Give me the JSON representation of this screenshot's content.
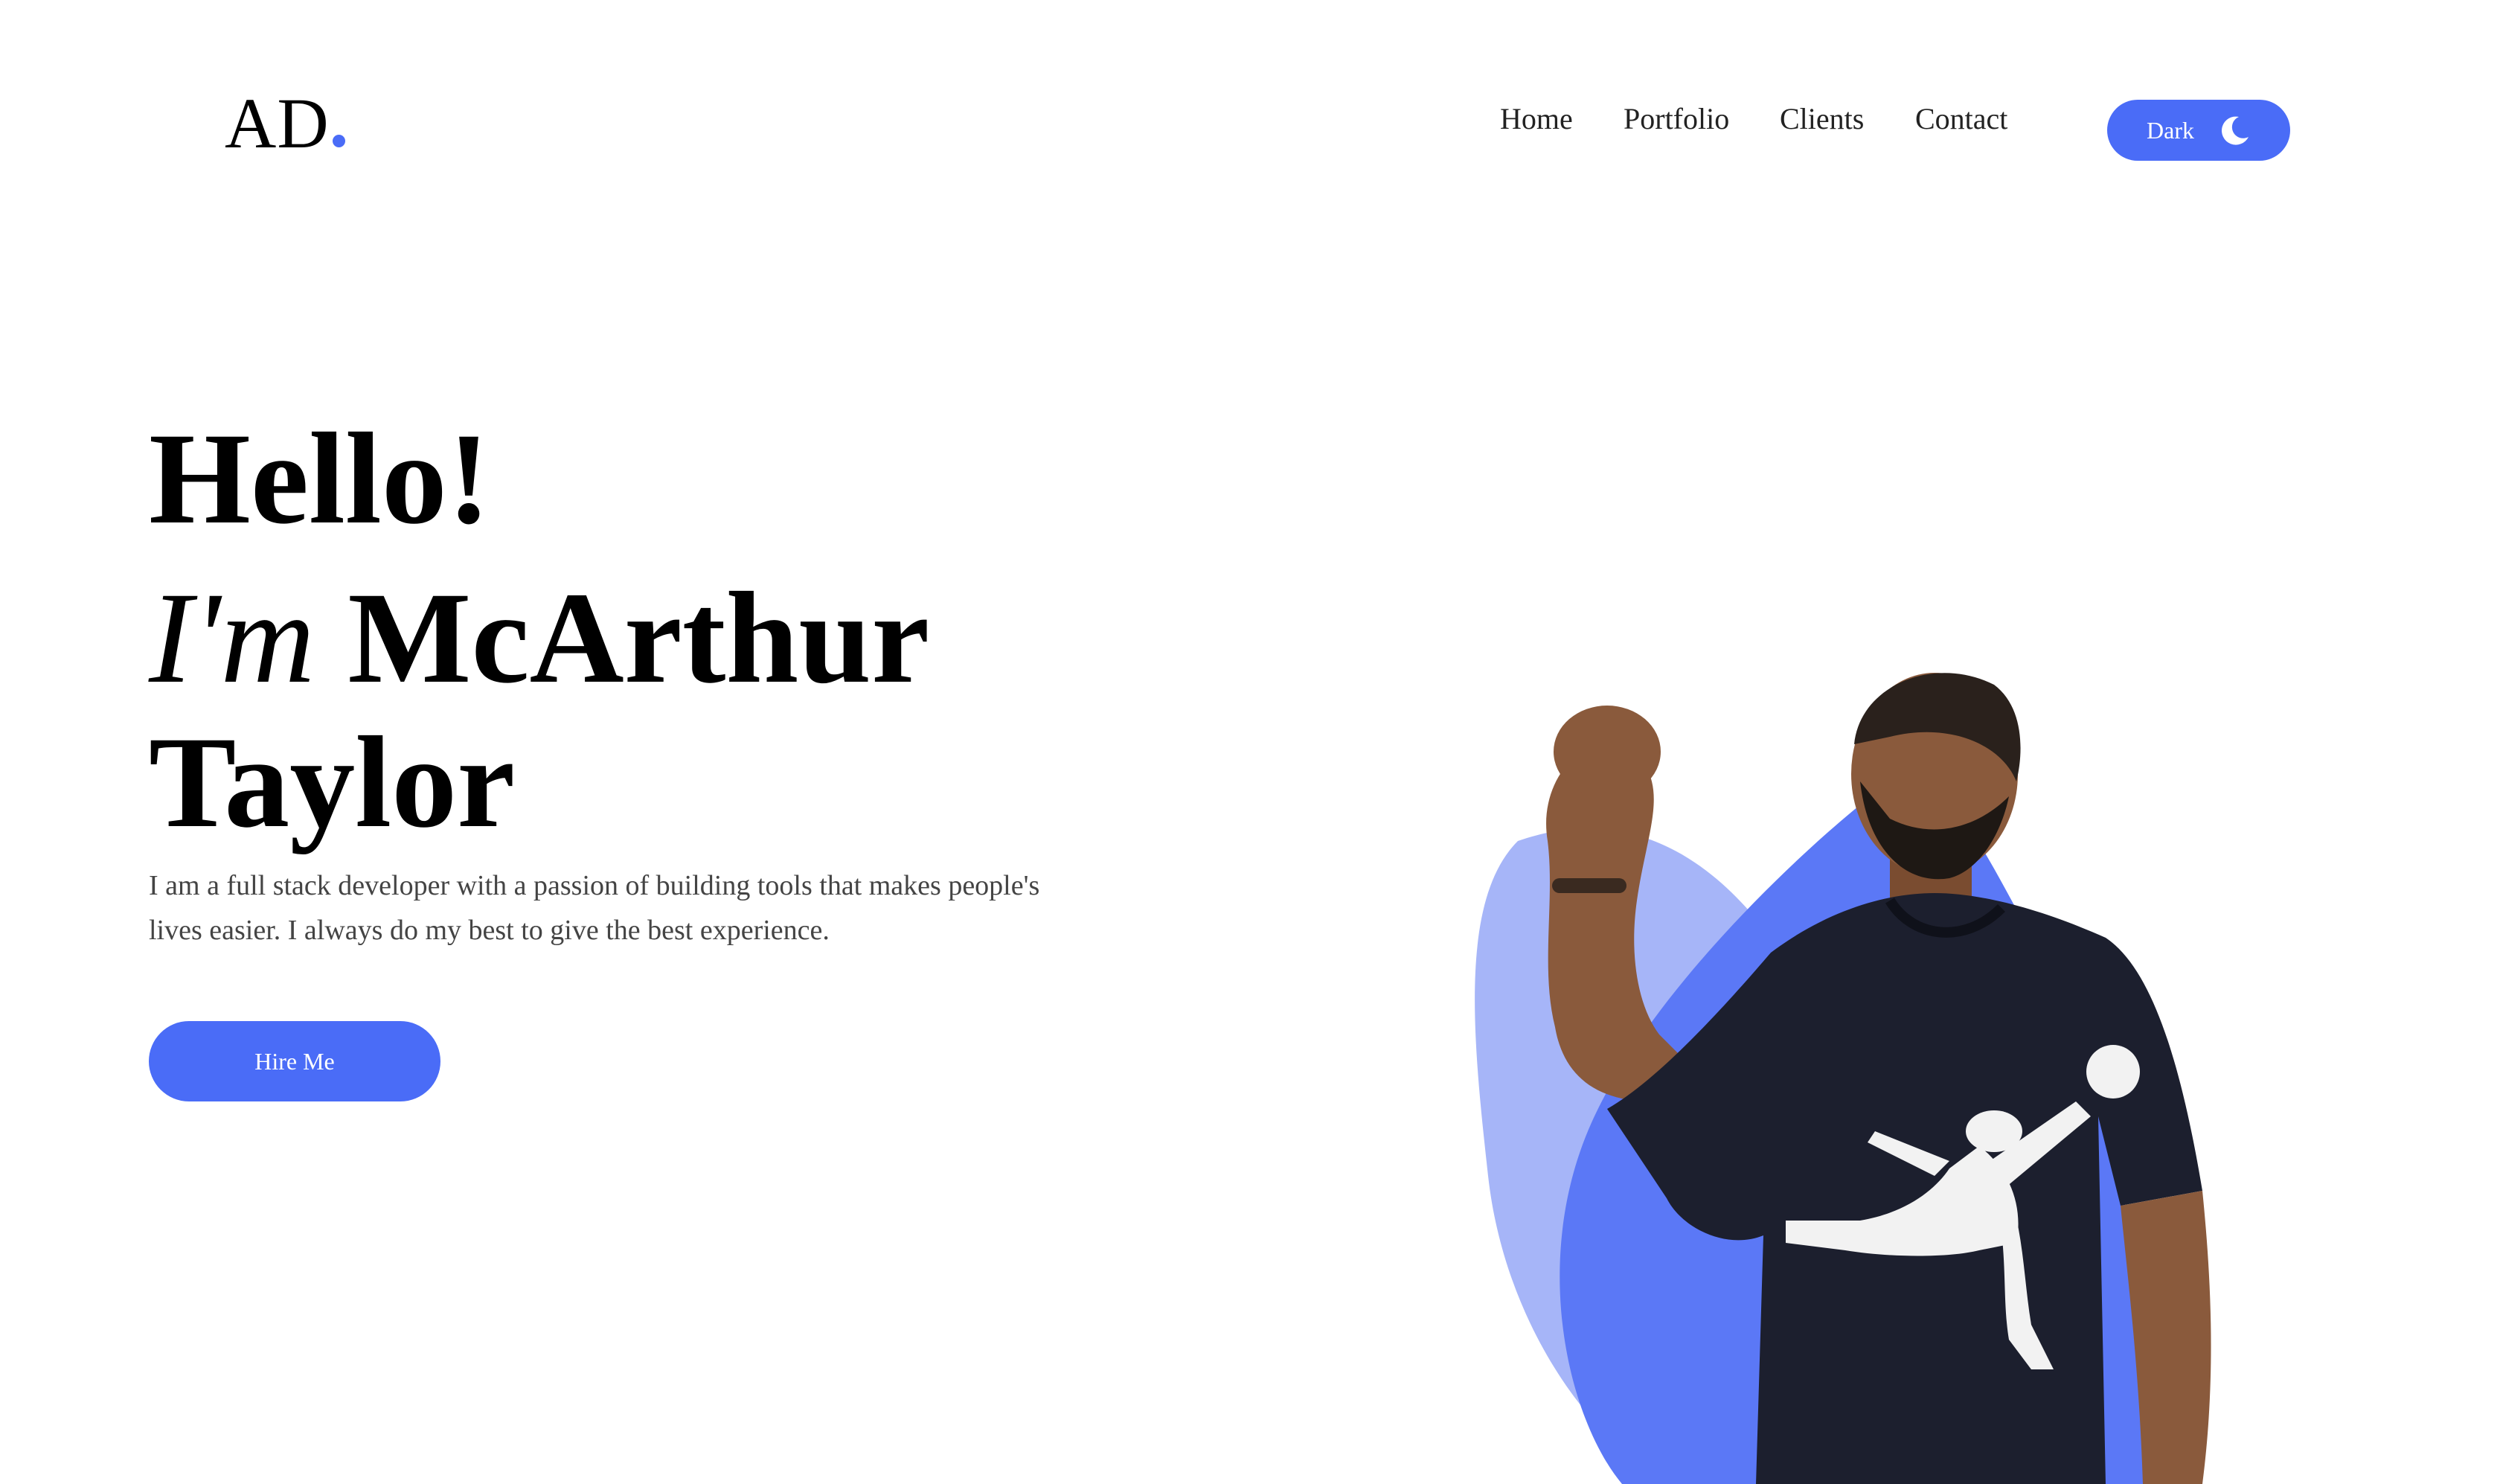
{
  "brand": {
    "logo_text": "AD",
    "accent_color": "#4a6cf7",
    "accent_light": "#a6b5f8"
  },
  "nav": {
    "items": [
      {
        "label": "Home"
      },
      {
        "label": "Portfolio"
      },
      {
        "label": "Clients"
      },
      {
        "label": "Contact"
      }
    ],
    "mode_toggle": {
      "label": "Dark",
      "icon": "moon-icon"
    }
  },
  "hero": {
    "greeting": "Hello!",
    "intro_prefix": "I'm",
    "first_name": "McArthur",
    "last_name": "Taylor",
    "description": "I am a full stack developer with a passion of building tools that makes people's lives easier. I always do my best to give the best experience.",
    "cta_label": "Hire Me",
    "image": "portrait-of-developer-flexing-arm"
  }
}
